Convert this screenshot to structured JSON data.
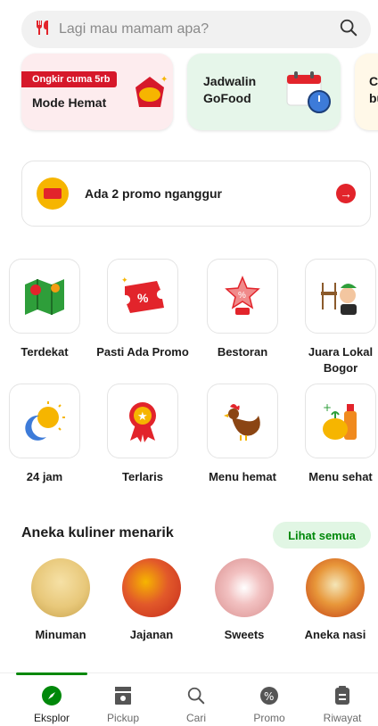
{
  "search": {
    "placeholder": "Lagi mau mamam apa?"
  },
  "cards": [
    {
      "ribbon": "Ongkir cuma 5rb",
      "title": "Mode Hemat"
    },
    {
      "title": "Jadwalin\nGoFood"
    },
    {
      "title": "Co\nbu"
    }
  ],
  "promo": {
    "text": "Ada 2 promo nganggur"
  },
  "categories": [
    {
      "label": "Terdekat",
      "icon": "map-icon"
    },
    {
      "label": "Pasti Ada Promo",
      "icon": "coupon-icon"
    },
    {
      "label": "Bestoran",
      "icon": "trophy-icon"
    },
    {
      "label": "Juara Lokal\nBogor",
      "icon": "chef-icon"
    },
    {
      "label": "24 jam",
      "icon": "sun-moon-icon"
    },
    {
      "label": "Terlaris",
      "icon": "medal-icon"
    },
    {
      "label": "Menu hemat",
      "icon": "chicken-icon"
    },
    {
      "label": "Menu sehat",
      "icon": "vegetable-icon"
    }
  ],
  "section": {
    "title": "Aneka kuliner menarik",
    "see_all": "Lihat semua"
  },
  "foods": [
    {
      "label": "Minuman",
      "color": "#e8c87a"
    },
    {
      "label": "Jajanan",
      "color": "#d6402a"
    },
    {
      "label": "Sweets",
      "color": "#e9a7a7"
    },
    {
      "label": "Aneka nasi",
      "color": "#d95a1e"
    }
  ],
  "nav": [
    {
      "label": "Eksplor",
      "icon": "compass-icon"
    },
    {
      "label": "Pickup",
      "icon": "pickup-icon"
    },
    {
      "label": "Cari",
      "icon": "search-icon"
    },
    {
      "label": "Promo",
      "icon": "promo-icon"
    },
    {
      "label": "Riwayat",
      "icon": "history-icon"
    }
  ],
  "colors": {
    "accent": "#00880a",
    "promo_red": "#e2242b"
  }
}
